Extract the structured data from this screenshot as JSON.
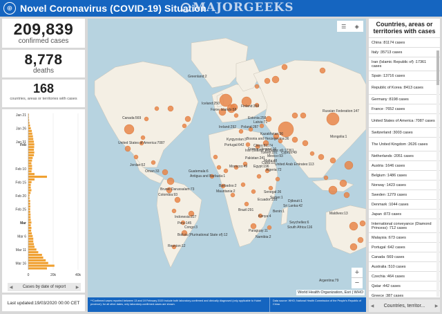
{
  "header": {
    "title": "Novel Coronavirus (COVID-19) Situation",
    "watermark": "MAJORGEEKS"
  },
  "stats": {
    "confirmed": {
      "value": "209,839",
      "label": "confirmed cases"
    },
    "deaths": {
      "value": "8,778",
      "label": "deaths"
    },
    "countries": {
      "value": "168",
      "label": "countries, areas or territories with cases"
    }
  },
  "chart_data": {
    "type": "bar",
    "orientation": "horizontal",
    "categories": [
      "Jan 21",
      "Jan 22",
      "Jan 23",
      "Jan 24",
      "Jan 25",
      "Jan 26",
      "Jan 27",
      "Jan 28",
      "Jan 29",
      "Jan 30",
      "Jan 31",
      "Feb 1",
      "Feb 2",
      "Feb 3",
      "Feb 4",
      "Feb 5",
      "Feb 6",
      "Feb 7",
      "Feb 8",
      "Feb 9",
      "Feb 10",
      "Feb 11",
      "Feb 12",
      "Feb 13",
      "Feb 14",
      "Feb 15",
      "Feb 16",
      "Feb 17",
      "Feb 18",
      "Feb 19",
      "Feb 20",
      "Feb 21",
      "Feb 22",
      "Feb 23",
      "Feb 24",
      "Feb 25",
      "Feb 26",
      "Feb 27",
      "Feb 28",
      "Feb 29",
      "Mar 1",
      "Mar 2",
      "Mar 3",
      "Mar 4",
      "Mar 5",
      "Mar 6",
      "Mar 7",
      "Mar 8",
      "Mar 9",
      "Mar 10",
      "Mar 11",
      "Mar 12",
      "Mar 13",
      "Mar 14",
      "Mar 15",
      "Mar 16",
      "Mar 17",
      "Mar 18"
    ],
    "values": [
      300,
      450,
      650,
      900,
      1400,
      2000,
      2800,
      3200,
      3700,
      4000,
      4500,
      4800,
      4700,
      4500,
      4800,
      4500,
      3500,
      3000,
      2500,
      3000,
      3000,
      2600,
      5000,
      15000,
      5000,
      2600,
      2000,
      2000,
      2500,
      1800,
      1000,
      1000,
      1500,
      1500,
      1600,
      1500,
      1600,
      1800,
      1800,
      2000,
      2500,
      2000,
      2500,
      2300,
      2800,
      3500,
      4000,
      4000,
      4500,
      5000,
      6500,
      8000,
      11000,
      12000,
      14000,
      16000,
      21000,
      15000
    ],
    "tick_labels": [
      "Jan 21",
      "Jan 26",
      "Jan 31",
      "Feb",
      "Feb 10",
      "Feb 15",
      "Feb 20",
      "Feb 25",
      "Mar",
      "Mar 6",
      "Mar 11",
      "Mar 16"
    ],
    "xticks": [
      "0",
      "20k",
      "40k"
    ],
    "xlim": [
      0,
      40000
    ],
    "color": "#f0a030"
  },
  "chart_footer": {
    "label": "Cases by date of report"
  },
  "updated": "Last updated:19/03/2020 00:00 CET",
  "map": {
    "attribution": "World Health Organization, Esri | WHO",
    "zoom_in": "+",
    "zoom_out": "−",
    "labels": [
      "Greenland:2",
      "Iceland:250",
      "Faroe Islands:58",
      "Finland:359",
      "Russian Federation:147",
      "Canada:569",
      "Estonia:258",
      "Latvia:71",
      "Ireland:292",
      "Poland:287",
      "Kazakhstan:36",
      "Mongolia:1",
      "United States of America:7087",
      "Portugal:642",
      "Bosnia and Herzegovina:36",
      "Kyrgyzstan:3",
      "China:81174",
      "France Ukraine:16",
      "Turkey:191",
      "Cyprus:49",
      "Iran (Islamic Republic of):17361",
      "Mexico:93",
      "Malta:48",
      "Jordan:52",
      "Pakistan:241",
      "Cuba:10",
      "Morocco:49",
      "Egypt:196",
      "Algeria:72",
      "United Arab Emirates:113",
      "Oman:33",
      "Guatemala:6",
      "Antigua and Barbuda:1",
      "Barbados:2",
      "Mauritania:2",
      "Senegal:36",
      "Sudan:1",
      "Djibouti:1",
      "Sri Lanka:42",
      "Maldives:13",
      "Brunei Darussalam:73",
      "Colombia:93",
      "Ecuador:155",
      "Benin:1",
      "Kenya:4",
      "Seychelles:6",
      "Indonesia:227",
      "Peru:145",
      "Brazil:291",
      "Congo:3",
      "Bolivia (Plurinational State of):12",
      "Paraguay:11",
      "Namibia:2",
      "South Africa:116",
      "Reunion:12",
      "Argentina:79"
    ],
    "footer_left": "**Confirmed cases reported between 13 and 19 February 2020 include both laboratory-confirmed and clinically diagnosed (only applicable to Hubei province); for all other dates, only laboratory-confirmed cases are shown.",
    "footer_right": "Data source: WHO; National Health Commission of the People's Republic of China"
  },
  "list": {
    "title": "Countries, areas or territories with cases",
    "items": [
      "China :81174 cases",
      "Italy :35713 cases",
      "Iran (Islamic Republic of) :17361 cases",
      "Spain :13716 cases",
      "Republic of Korea :8413 cases",
      "Germany :8198 cases",
      "France :7652 cases",
      "United States of America :7087 cases",
      "Switzerland :3003 cases",
      "The United Kingdom :2626 cases",
      "Netherlands :2051 cases",
      "Austria :1646 cases",
      "Belgium :1486 cases",
      "Norway :1423 cases",
      "Sweden :1279 cases",
      "Denmark :1044 cases",
      "Japan :873 cases",
      "International conveyance (Diamond Princess) :712 cases",
      "Malaysia :673 cases",
      "Portugal :642 cases",
      "Canada :569 cases",
      "Australia :510 cases",
      "Czechia :464 cases",
      "Qatar :442 cases",
      "Greece :387 cases"
    ],
    "footer_label": "Countries, territor..."
  }
}
